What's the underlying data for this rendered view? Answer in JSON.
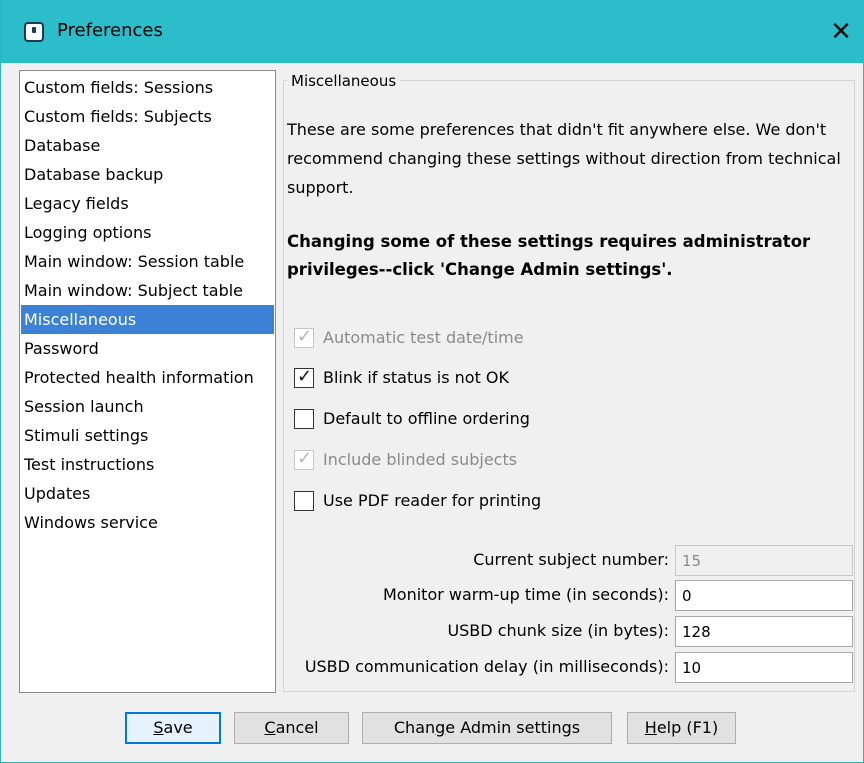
{
  "window": {
    "title": "Preferences",
    "close_glyph": "✕"
  },
  "nav": {
    "selected_index": 8,
    "items": [
      "Custom fields: Sessions",
      "Custom fields: Subjects",
      "Database",
      "Database backup",
      "Legacy fields",
      "Logging options",
      "Main window: Session table",
      "Main window: Subject table",
      "Miscellaneous",
      "Password",
      "Protected health information",
      "Session launch",
      "Stimuli settings",
      "Test instructions",
      "Updates",
      "Windows service"
    ]
  },
  "panel": {
    "group_title": "Miscellaneous",
    "description": "These are some preferences that didn't fit anywhere else. We don't recommend changing these settings without direction from technical support.",
    "warning": "Changing some of these settings requires administrator privileges--click 'Change Admin settings'."
  },
  "checkboxes": [
    {
      "label": "Automatic test date/time",
      "checked": true,
      "disabled": true
    },
    {
      "label": "Blink if status is not OK",
      "checked": true,
      "disabled": false
    },
    {
      "label": "Default to offline ordering",
      "checked": false,
      "disabled": false
    },
    {
      "label": "Include blinded subjects",
      "checked": true,
      "disabled": true
    },
    {
      "label": "Use PDF reader for printing",
      "checked": false,
      "disabled": false
    }
  ],
  "fields": [
    {
      "label": "Current subject number:",
      "value": "15",
      "disabled": true
    },
    {
      "label": "Monitor warm-up time (in seconds):",
      "value": "0",
      "disabled": false
    },
    {
      "label": "USBD chunk size (in bytes):",
      "value": "128",
      "disabled": false
    },
    {
      "label": "USBD communication delay (in milliseconds):",
      "value": "10",
      "disabled": false
    }
  ],
  "buttons": {
    "save": {
      "pre": "",
      "mnemonic": "S",
      "post": "ave"
    },
    "cancel": {
      "pre": "",
      "mnemonic": "C",
      "post": "ancel"
    },
    "admin": {
      "pre": "Chan",
      "mnemonic": "g",
      "post": "e Admin settings"
    },
    "help": {
      "pre": "",
      "mnemonic": "H",
      "post": "elp (F1)"
    }
  },
  "colors": {
    "titlebar": "#2bbdca",
    "selection": "#3b82d6",
    "default_button_border": "#0078d7"
  }
}
